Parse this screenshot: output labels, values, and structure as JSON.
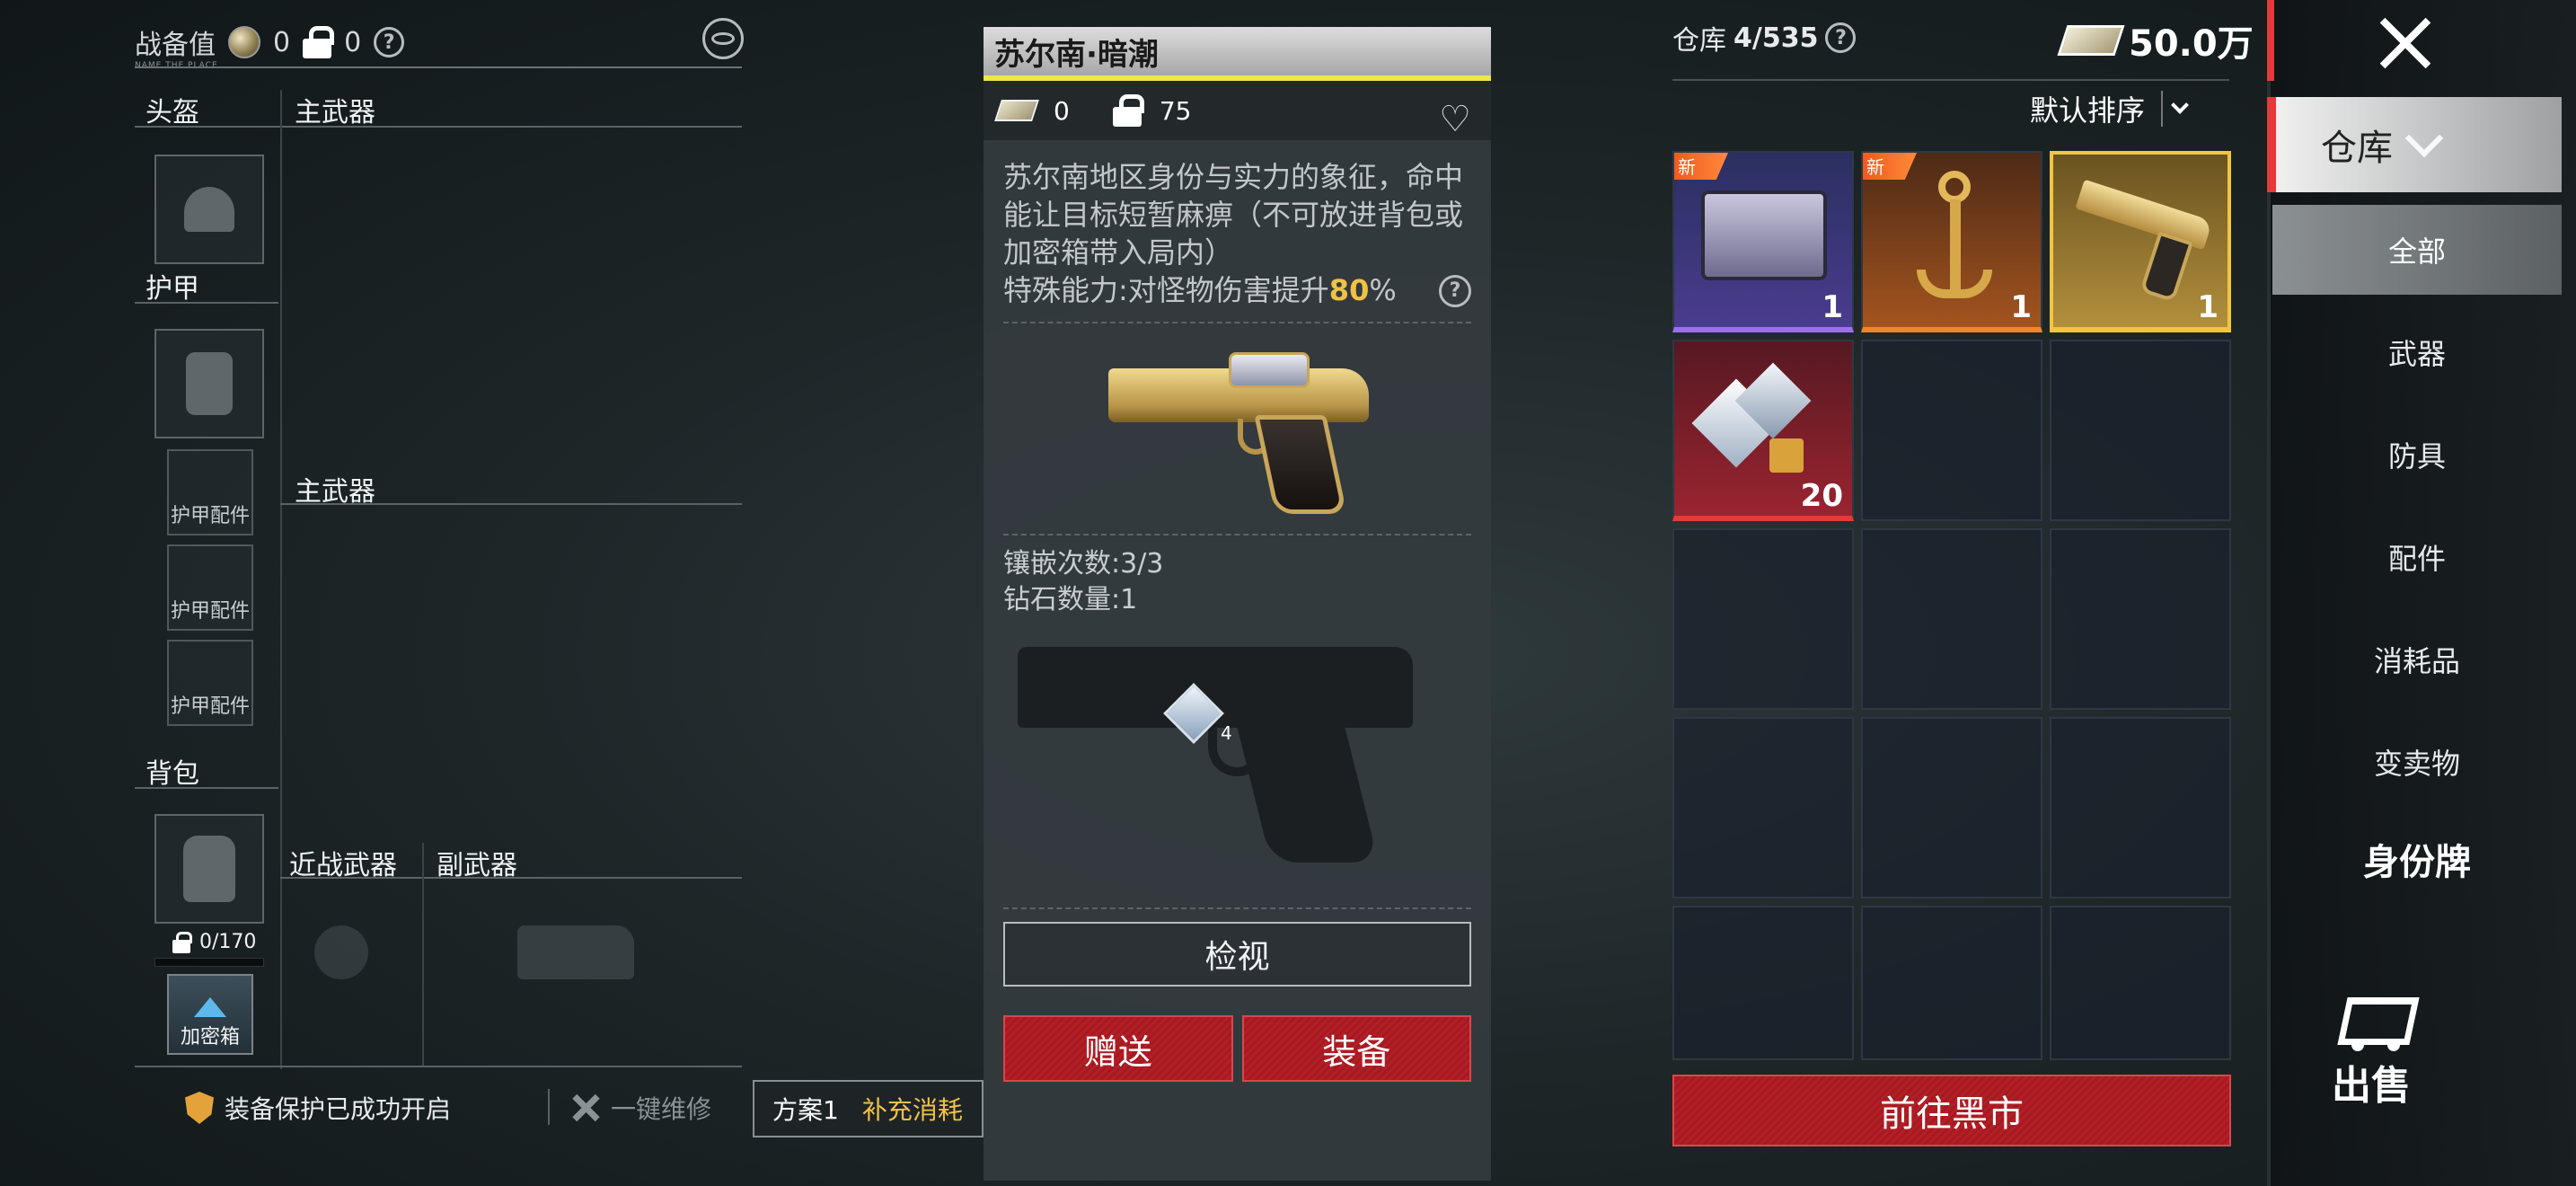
{
  "loadout": {
    "title": "战备值",
    "coins": "0",
    "locked": "0",
    "help": "?",
    "subtitle": "NAME THE PLACE",
    "slots": {
      "helmet": "头盔",
      "primary1": "主武器",
      "armor": "护甲",
      "armor_attachment": "护甲配件",
      "primary2": "主武器",
      "backpack": "背包",
      "melee": "近战武器",
      "secondary": "副武器",
      "capacity": "0/170",
      "secure_box": "加密箱"
    },
    "bottom": {
      "protection": "装备保护已成功开启",
      "repair": "一键维修",
      "plan": "方案1",
      "refill": "补充消耗"
    }
  },
  "detail": {
    "name": "苏尔南·暗潮",
    "price": "0",
    "locked": "75",
    "heart": "♡",
    "description": "苏尔南地区身份与实力的象征，命中能让目标短暂麻痹（不可放进背包或加密箱带入局内）",
    "ability_prefix": "特殊能力:对怪物伤害提升",
    "ability_value": "80",
    "ability_suffix": "%",
    "help": "?",
    "inlay_count": "镶嵌次数:3/3",
    "diamond_count": "钻石数量:1",
    "diamond_badge": "4",
    "inspect": "检视",
    "gift": "赠送",
    "equip": "装备"
  },
  "warehouse": {
    "label": "仓库",
    "capacity": "4/535",
    "help": "?",
    "money": "50.0万",
    "sort": "默认排序",
    "items": [
      {
        "icon": "supply-case-icon",
        "rarity": "purple",
        "new": "新",
        "count": "1"
      },
      {
        "icon": "golden-anchor-icon",
        "rarity": "orange",
        "new": "新",
        "count": "1"
      },
      {
        "icon": "golden-pistol-icon",
        "rarity": "gold",
        "new": "",
        "count": "1"
      },
      {
        "icon": "diamonds-icon",
        "rarity": "red",
        "new": "",
        "count": "20"
      }
    ],
    "black_market": "前往黑市"
  },
  "nav": {
    "active": "仓库",
    "items": [
      "全部",
      "武器",
      "防具",
      "配件",
      "消耗品",
      "变卖物"
    ],
    "selected": "全部",
    "id_tag": "身份牌",
    "sell": "出售"
  },
  "colors": {
    "accent_red": "#b41e26",
    "highlight": "#f0c244",
    "title_bar_underline": "#ece74a"
  }
}
